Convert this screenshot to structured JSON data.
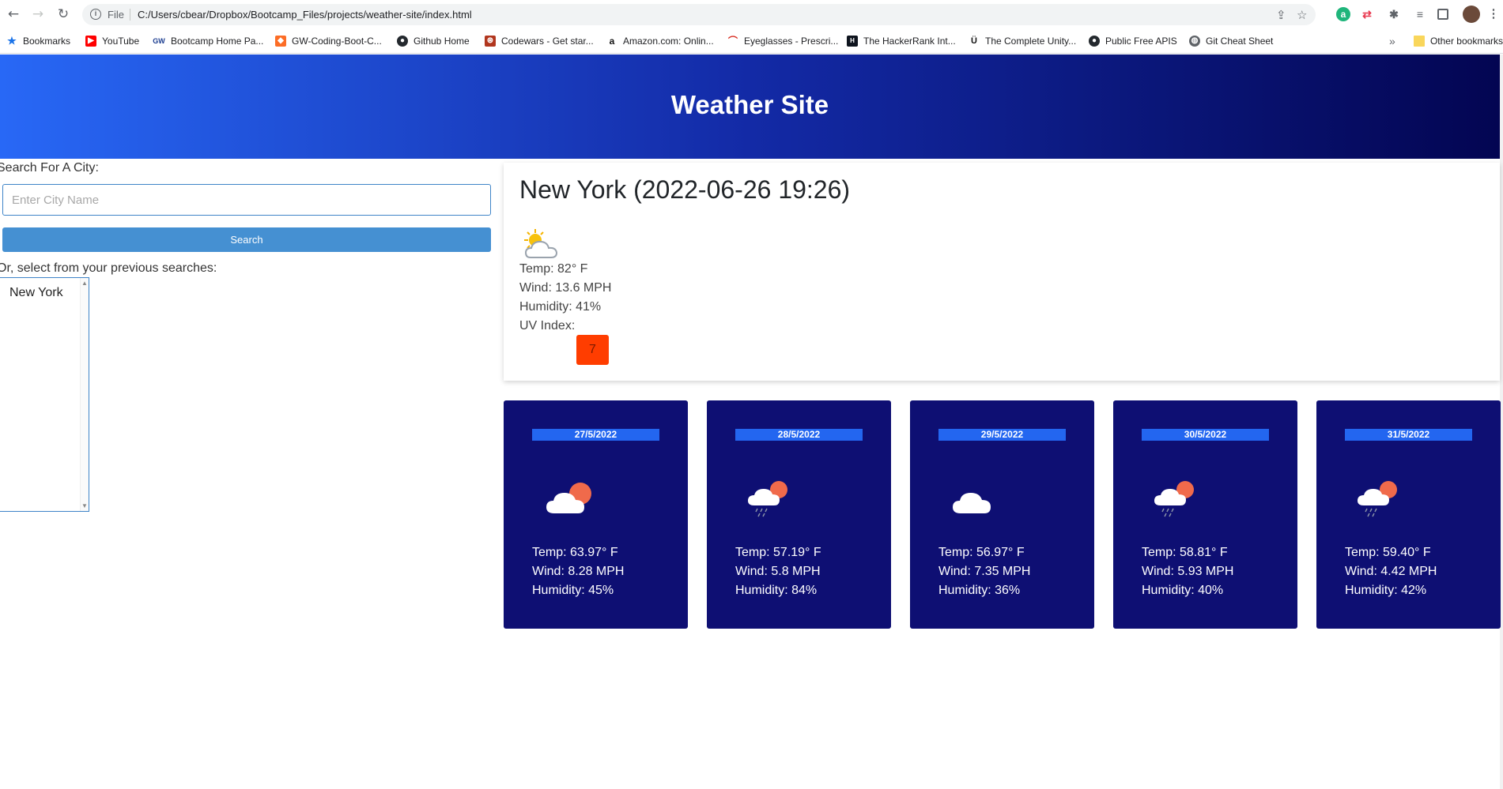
{
  "browser": {
    "scheme_label": "File",
    "url": "C:/Users/cbear/Dropbox/Bootcamp_Files/projects/weather-site/index.html",
    "bookmarks": [
      {
        "label": "Bookmarks",
        "icon": "star-icon"
      },
      {
        "label": "YouTube",
        "icon": "youtube-icon"
      },
      {
        "label": "Bootcamp Home Pa...",
        "icon": "gw-icon"
      },
      {
        "label": "GW-Coding-Boot-C...",
        "icon": "gitlab-icon"
      },
      {
        "label": "Github Home",
        "icon": "github-icon"
      },
      {
        "label": "Codewars - Get star...",
        "icon": "codewars-icon"
      },
      {
        "label": "Amazon.com: Onlin...",
        "icon": "amazon-icon"
      },
      {
        "label": "Eyeglasses - Prescri...",
        "icon": "eyeglasses-icon"
      },
      {
        "label": "The HackerRank Int...",
        "icon": "hackerrank-icon"
      },
      {
        "label": "The Complete Unity...",
        "icon": "udemy-icon"
      },
      {
        "label": "Public Free APIS",
        "icon": "github-icon"
      },
      {
        "label": "Git Cheat Sheet",
        "icon": "globe-icon"
      }
    ],
    "overflow": "»",
    "other_bookmarks": "Other bookmarks"
  },
  "header": {
    "title": "Weather Site"
  },
  "search": {
    "label": "Search For A City:",
    "placeholder": "Enter City Name",
    "button_label": "Search",
    "previous_label": "Or, select from your previous searches:",
    "history": [
      "New York"
    ]
  },
  "current": {
    "title": "New York (2022-06-26 19:26)",
    "icon": "partly-sunny-icon",
    "temp": "Temp: 82° F",
    "wind": "Wind: 13.6 MPH",
    "humidity": "Humidity: 41%",
    "uv_label": "UV Index:",
    "uv_value": "7",
    "uv_color": "#ff3d00"
  },
  "forecast": [
    {
      "date": "27/5/2022",
      "icon": "cloud-sun-icon",
      "temp": "Temp: 63.97° F",
      "wind": "Wind: 8.28 MPH",
      "humidity": "Humidity: 45%"
    },
    {
      "date": "28/5/2022",
      "icon": "rain-sun-icon",
      "temp": "Temp: 57.19° F",
      "wind": "Wind: 5.8 MPH",
      "humidity": "Humidity: 84%"
    },
    {
      "date": "29/5/2022",
      "icon": "cloud-icon",
      "temp": "Temp: 56.97° F",
      "wind": "Wind: 7.35 MPH",
      "humidity": "Humidity: 36%"
    },
    {
      "date": "30/5/2022",
      "icon": "rain-sun-icon",
      "temp": "Temp: 58.81° F",
      "wind": "Wind: 5.93 MPH",
      "humidity": "Humidity: 40%"
    },
    {
      "date": "31/5/2022",
      "icon": "rain-sun-icon",
      "temp": "Temp: 59.40° F",
      "wind": "Wind: 4.42 MPH",
      "humidity": "Humidity: 42%"
    }
  ],
  "colors": {
    "header_start": "#2868f6",
    "header_end": "#030552",
    "card_bg": "#0e0f73",
    "date_bar": "#2366f0",
    "button": "#4590d2"
  }
}
